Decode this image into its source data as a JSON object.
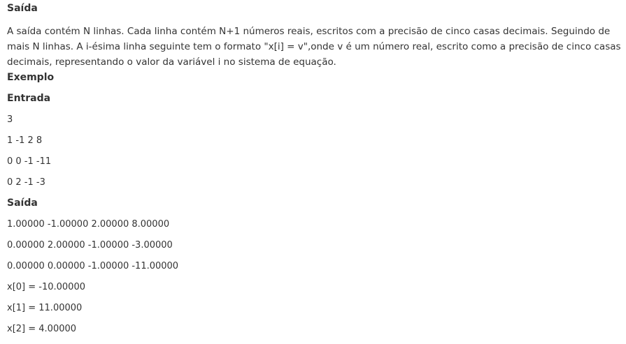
{
  "output_section": {
    "title": "Saída",
    "description_lines": [
      "A saída contém N linhas. Cada linha contém N+1 números reais, escritos com a precisão de cinco casas decimais. Seguindo de",
      "mais N linhas. A i-ésima linha seguinte tem o formato \"x[i] = v\",onde v é um número real, escrito como a precisão de cinco casas",
      "decimais, representando o valor da variável i no sistema de equação."
    ]
  },
  "example": {
    "title": "Exemplo",
    "input_title": "Entrada",
    "input_lines": [
      "3",
      "1 -1 2 8",
      "0 0 -1 -11",
      "0 2 -1 -3"
    ],
    "output_title": "Saída",
    "output_lines": [
      "1.00000 -1.00000 2.00000 8.00000",
      "0.00000 2.00000 -1.00000 -3.00000",
      "0.00000 0.00000 -1.00000 -11.00000",
      "x[0] = -10.00000",
      "x[1] = 11.00000",
      "x[2] = 4.00000"
    ]
  }
}
